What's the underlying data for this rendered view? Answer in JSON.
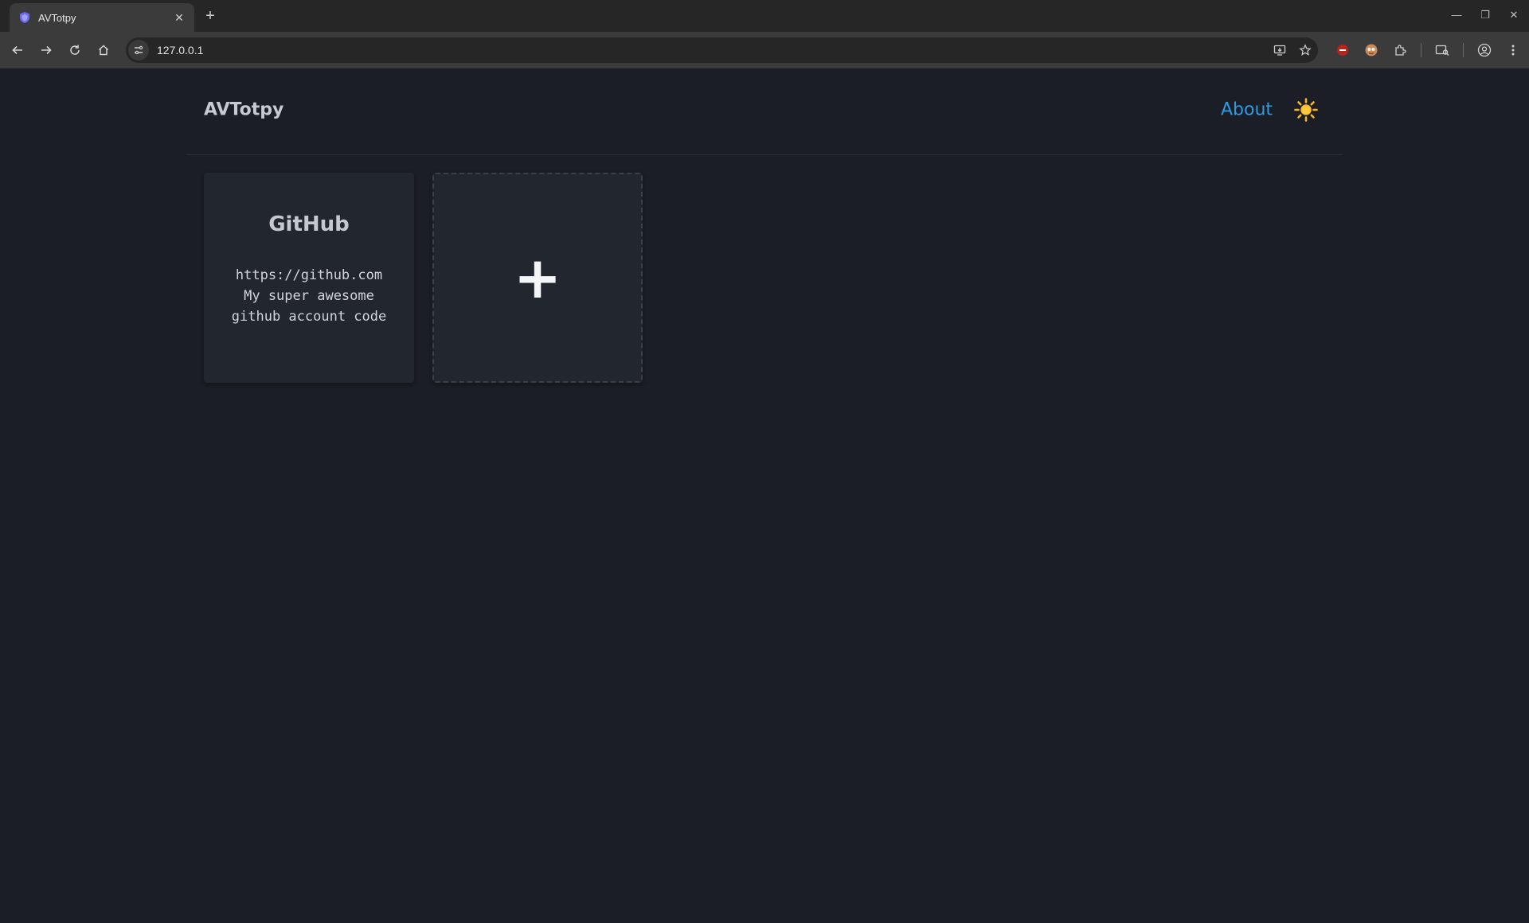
{
  "browser": {
    "tab": {
      "title": "AVTotpy",
      "favicon": "shield-favicon"
    },
    "address": {
      "url": "127.0.0.1"
    },
    "window_controls": [
      "minimize",
      "restore",
      "close"
    ]
  },
  "header": {
    "brand": "AVTotpy",
    "nav": {
      "about_label": "About"
    },
    "theme_toggle_icon": "sun-icon"
  },
  "cards": [
    {
      "title": "GitHub",
      "lines": [
        "https://github.com",
        "My super awesome",
        "github account code"
      ]
    }
  ],
  "add_card": {
    "glyph": "+"
  },
  "colors": {
    "background": "#1b1e26",
    "card": "#22262f",
    "link": "#2d9be3",
    "sun": "#f5b52a"
  }
}
